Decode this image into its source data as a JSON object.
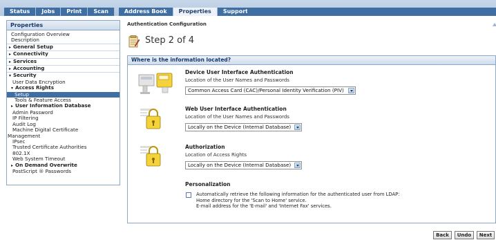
{
  "tabs": [
    {
      "label": "Status"
    },
    {
      "label": "Jobs"
    },
    {
      "label": "Print"
    },
    {
      "label": "Scan"
    },
    {
      "label": "Address Book"
    },
    {
      "label": "Properties"
    },
    {
      "label": "Support"
    }
  ],
  "sidebar": {
    "title": "Properties",
    "items": [
      {
        "label": "Configuration Overview"
      },
      {
        "label": "Description"
      },
      {
        "label": "General Setup"
      },
      {
        "label": "Connectivity"
      },
      {
        "label": "Services"
      },
      {
        "label": "Accounting"
      },
      {
        "label": "Security"
      },
      {
        "label": "User Data Encryption"
      },
      {
        "label": "Access Rights"
      },
      {
        "label": "Setup"
      },
      {
        "label": "Tools & Feature Access"
      },
      {
        "label": "User Information Database"
      },
      {
        "label": "Admin Password"
      },
      {
        "label": "IP Filtering"
      },
      {
        "label": "Audit Log"
      },
      {
        "label": "Machine Digital Certificate"
      },
      {
        "label": "Management"
      },
      {
        "label": "IPsec"
      },
      {
        "label": "Trusted Certificate Authorities"
      },
      {
        "label": "802.1X"
      },
      {
        "label": "Web System Timeout"
      },
      {
        "label": "On Demand Overwrite"
      },
      {
        "label": "PostScript ® Passwords"
      }
    ]
  },
  "main": {
    "breadcrumb": "Authentication Configuration",
    "step": "Step 2 of 4",
    "panel_title": "Where is the information located?",
    "sections": [
      {
        "title": "Device User Interface Authentication",
        "subtitle": "Location of the User Names and Passwords",
        "selected": "Common Access Card (CAC)/Personal Identity Verification (PIV)"
      },
      {
        "title": "Web User Interface Authentication",
        "subtitle": "Location of the User Names and Passwords",
        "selected": "Locally on the Device (Internal Database)"
      },
      {
        "title": "Authorization",
        "subtitle": "Location of Access Rights",
        "selected": "Locally on the Device (Internal Database)"
      }
    ],
    "personalization": {
      "title": "Personalization",
      "line1": "Automatically retrieve the following information for the authenticated user from LDAP:",
      "line2": "Home directory for the 'Scan to Home' service.",
      "line3": "E-mail address for the 'E-mail' and 'Internet Fax' services.",
      "checked": false
    }
  },
  "buttons": {
    "back": "Back",
    "undo": "Undo",
    "next": "Next"
  },
  "colors": {
    "nav_blue": "#3f6ea3",
    "border_blue": "#8aa6c8",
    "header_text": "#17386a"
  }
}
